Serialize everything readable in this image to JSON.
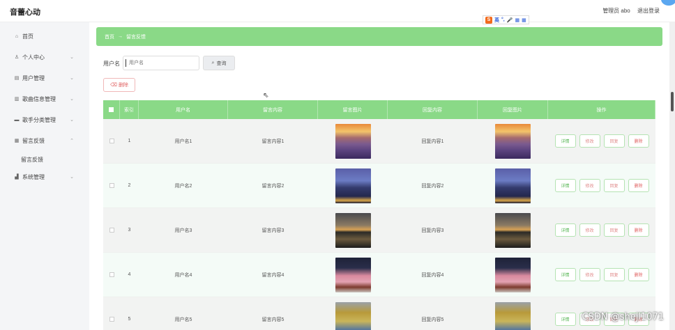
{
  "app": {
    "title": "音蕾心动"
  },
  "header": {
    "user_label": "管理员 abo",
    "logout_label": "退出登录"
  },
  "ime": {
    "logo": "S",
    "items": [
      "英",
      "·",
      "°,",
      "🎤",
      "▦",
      "▦"
    ]
  },
  "sidebar": {
    "items": [
      {
        "label": "首页",
        "icon": "home-icon"
      },
      {
        "label": "个人中心",
        "icon": "user-icon"
      },
      {
        "label": "用户管理",
        "icon": "user-manage-icon"
      },
      {
        "label": "歌曲信息管理",
        "icon": "music-icon"
      },
      {
        "label": "歌手分类管理",
        "icon": "category-icon"
      },
      {
        "label": "留言反馈",
        "icon": "grid-icon"
      },
      {
        "label": "系统管理",
        "icon": "system-icon"
      }
    ],
    "sub_item": "留言反馈"
  },
  "breadcrumb": {
    "home": "首页",
    "current": "留言反馈"
  },
  "search": {
    "label": "用户名",
    "placeholder": "用户名",
    "button_label": "查询"
  },
  "toolbar": {
    "delete_label": "删除"
  },
  "table": {
    "headers": [
      "索引",
      "用户名",
      "留言内容",
      "留言图片",
      "回复内容",
      "回复图片",
      "操作"
    ],
    "rows": [
      {
        "index": "1",
        "user": "用户名1",
        "message": "留言内容1",
        "reply": "回复内容1",
        "image": "lavender-field"
      },
      {
        "index": "2",
        "user": "用户名2",
        "message": "留言内容2",
        "reply": "回复内容2",
        "image": "pier-night"
      },
      {
        "index": "3",
        "user": "用户名3",
        "message": "留言内容3",
        "reply": "回复内容3",
        "image": "tree-lake"
      },
      {
        "index": "4",
        "user": "用户名4",
        "message": "留言内容4",
        "reply": "回复内容4",
        "image": "flower-vase"
      },
      {
        "index": "5",
        "user": "用户名5",
        "message": "留言内容5",
        "reply": "回复内容5",
        "image": "autumn-lake"
      }
    ],
    "actions": {
      "detail": "详情",
      "edit": "修改",
      "reply": "回复",
      "delete": "删除"
    }
  },
  "watermark": "CSDN @shejl1071"
}
